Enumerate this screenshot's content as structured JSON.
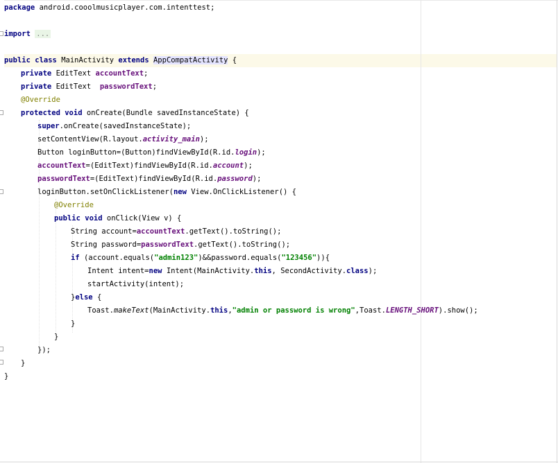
{
  "editor": {
    "lines": {
      "l1": {
        "kw1": "package",
        "rest": " android.cooolmusicplayer.com.intenttest;"
      },
      "l2": {
        "kw1": "import",
        "folded": "..."
      },
      "l3": {
        "kw1": "public",
        "kw2": "class",
        "name": "MainActivity",
        "kw3": "extends",
        "parent": "AppCompatActivity",
        "brace": "{"
      },
      "l4": {
        "kw1": "private",
        "type": "EditText",
        "field": "accountText",
        "end": ";"
      },
      "l5": {
        "kw1": "private",
        "type": "EditText",
        "field": "passwordText",
        "end": ";"
      },
      "l6": {
        "ann": "@Override"
      },
      "l7": {
        "kw1": "protected",
        "kw2": "void",
        "rest": "onCreate(Bundle savedInstanceState) {"
      },
      "l8": {
        "kw1": "super",
        "rest": ".onCreate(savedInstanceState);"
      },
      "l9": {
        "pre": "setContentView(R.layout.",
        "field": "activity_main",
        "end": ");"
      },
      "l10": {
        "pre": "Button loginButton=(Button)findViewById(R.id.",
        "field": "login",
        "end": ");"
      },
      "l11": {
        "field": "accountText",
        "pre": "=(EditText)findViewById(R.id.",
        "field2": "account",
        "end": ");"
      },
      "l12": {
        "field": "passwordText",
        "pre": "=(EditText)findViewById(R.id.",
        "field2": "password",
        "end": ");"
      },
      "l13": {
        "pre": "loginButton.setOnClickListener(",
        "kw1": "new",
        "rest": "View.OnClickListener() {"
      },
      "l14": {
        "ann": "@Override"
      },
      "l15": {
        "kw1": "public",
        "kw2": "void",
        "rest": "onClick(View v) {"
      },
      "l16": {
        "pre": "String account=",
        "field": "accountText",
        "end": ".getText().toString();"
      },
      "l17": {
        "pre": "String password=",
        "field": "passwordText",
        "end": ".getText().toString();"
      },
      "l18": {
        "kw1": "if",
        "pre": "(account.equals(",
        "str1": "\"admin123\"",
        "mid": ")&&password.equals(",
        "str2": "\"123456\"",
        "end": ")){"
      },
      "l19": {
        "pre": "Intent intent=",
        "kw1": "new",
        "mid": "Intent(MainActivity.",
        "kw2": "this",
        "mid2": ", SecondActivity.",
        "kw3": "class",
        "end": ");"
      },
      "l20": {
        "rest": "startActivity(intent);"
      },
      "l21": {
        "pre": "}",
        "kw1": "else",
        "end": "{"
      },
      "l22": {
        "pre": "Toast.",
        "method": "makeText",
        "mid": "(MainActivity.",
        "kw1": "this",
        "comma": ",",
        "str1": "\"admin or password is wrong\"",
        "mid2": ",Toast.",
        "field": "LENGTH_SHORT",
        "end": ").show();"
      },
      "l23": {
        "rest": "}"
      },
      "l24": {
        "rest": "}"
      },
      "l25": {
        "rest": "});"
      },
      "l26": {
        "rest": "}"
      },
      "l27": {
        "rest": "}"
      }
    }
  },
  "colors": {
    "keyword": "#000080",
    "field": "#660e7a",
    "string": "#008000",
    "annotation": "#808000",
    "current_line": "#fcf9e8"
  }
}
